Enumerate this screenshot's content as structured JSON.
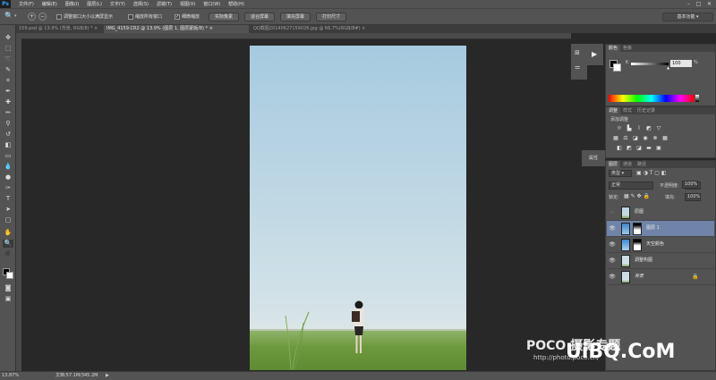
{
  "app": {
    "logo": "Ps"
  },
  "menu": [
    "文件(F)",
    "编辑(E)",
    "图像(I)",
    "图层(L)",
    "文字(Y)",
    "选择(S)",
    "滤镜(T)",
    "视图(V)",
    "窗口(W)",
    "帮助(H)"
  ],
  "window_controls": {
    "minimize": "–",
    "restore": "□",
    "close": "✕"
  },
  "options": {
    "resize_windows_label": "调整窗口大小以满屏显示",
    "zoom_all_label": "缩放所有窗口",
    "scrubby_zoom_label": "细微缩放",
    "actual_pixels_label": "实际像素",
    "fit_screen_label": "适合屏幕",
    "fill_screen_label": "填充屏幕",
    "print_size_label": "打印尺寸",
    "workspace": "基本功能"
  },
  "tabs": [
    {
      "label": "159.psd @ 13.9% (背景, RGB/8) *",
      "active": false
    },
    {
      "label": "IMG_4159.CR2 @ 13.9% (图层 1, 图层蒙版/8) *",
      "active": true
    },
    {
      "label": "QQ截图20140627159026.jpg @ 66.7%(RGB/8#)",
      "active": false
    }
  ],
  "status": {
    "zoom": "13.87%",
    "doc": "文档:57.1M/345.2M"
  },
  "color_panel": {
    "tabs": [
      "颜色",
      "色板"
    ],
    "channel_label": "K",
    "value": "100",
    "unit": "%"
  },
  "adjust_panel": {
    "tabs": [
      "调整",
      "样式",
      "历史记录"
    ],
    "title": "添加调整"
  },
  "side_props_label": "属性",
  "layers_panel": {
    "tabs": [
      "图层",
      "通道",
      "路径"
    ],
    "filter_label": "类型",
    "blend_mode": "正常",
    "opacity_label": "不透明度:",
    "opacity_value": "10%",
    "lock_label": "锁定:",
    "fill_label": "填充:",
    "fill_value": "100%",
    "extra_percent": "100%",
    "layers": [
      {
        "name": "原图",
        "visible": false,
        "selected": false
      },
      {
        "name": "图层 1",
        "visible": true,
        "selected": true
      },
      {
        "name": "天空颜色",
        "visible": true,
        "selected": false
      },
      {
        "name": "调整构图",
        "visible": true,
        "selected": false
      },
      {
        "name": "背景",
        "visible": true,
        "selected": false,
        "locked": true
      }
    ]
  },
  "watermark": {
    "poco": "POCO 摄影专题",
    "url": "http://photo.poco.cn/",
    "brand": "UiBQ.CoM"
  },
  "colors": {
    "accent": "#31a8ff",
    "selected_layer": "#6f84a8"
  }
}
